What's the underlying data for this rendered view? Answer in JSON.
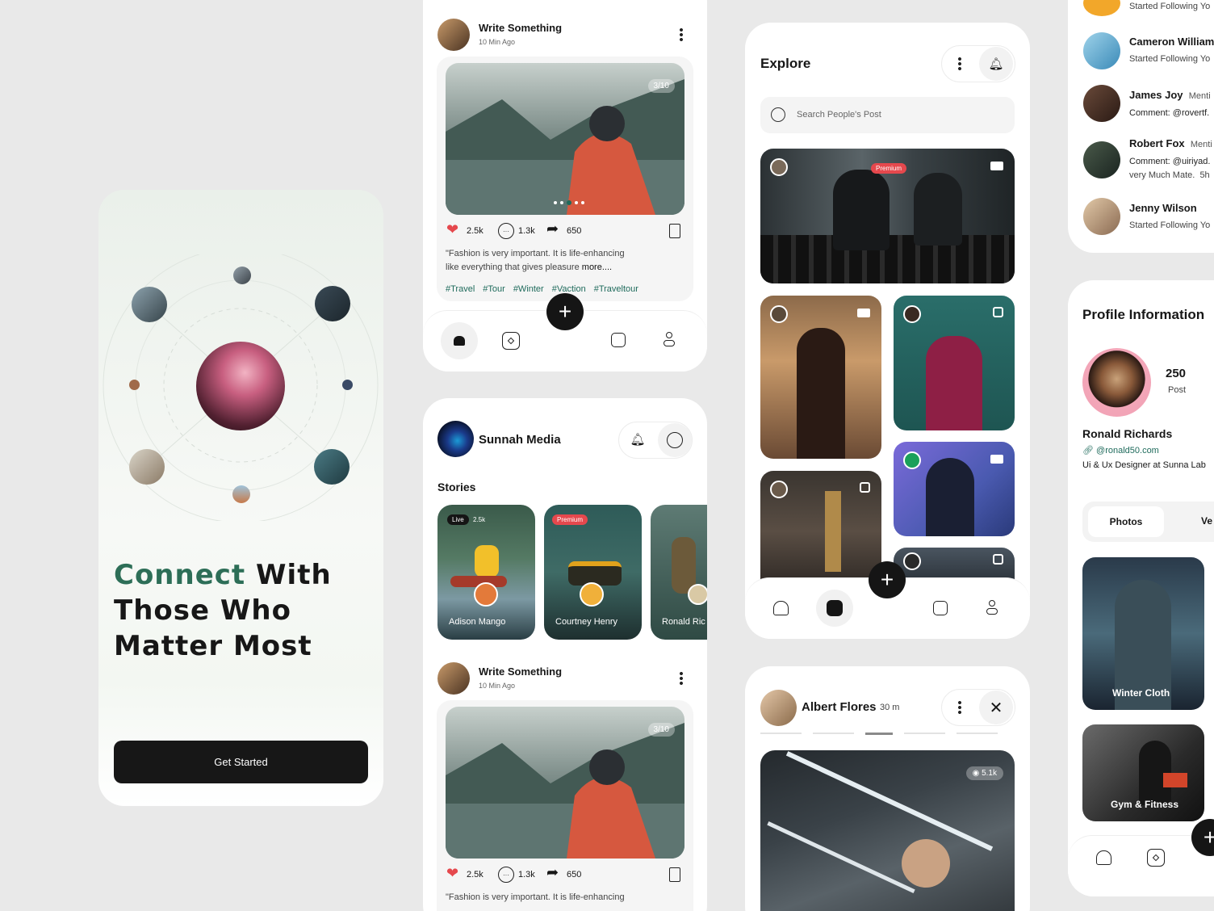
{
  "onboarding": {
    "headline_accent": "Connect",
    "headline_1": "With",
    "headline_2": "Those Who",
    "headline_3": "Matter Most",
    "cta": "Get Started"
  },
  "post": {
    "title": "Write Something",
    "time": "10 Min Ago",
    "counter": "3/10",
    "likes": "2.5k",
    "comments": "1.3k",
    "shares": "650",
    "caption_1": "\"Fashion is very important. It is life-enhancing",
    "caption_2": "like everything that gives pleasure",
    "more": "more....",
    "tags": [
      "#Travel",
      "#Tour",
      "#Winter",
      "#Vaction",
      "#Traveltour"
    ]
  },
  "feed": {
    "brand": "Sunnah Media",
    "stories_title": "Stories",
    "stories": [
      {
        "name": "Adison Mango",
        "badge": "Live",
        "count": "2.5k"
      },
      {
        "name": "Courtney Henry",
        "badge": "Premium"
      },
      {
        "name": "Ronald Ric"
      }
    ]
  },
  "explore": {
    "title": "Explore",
    "search_placeholder": "Search People's Post",
    "premium": "Premium"
  },
  "story_view": {
    "name": "Albert Flores",
    "time": "30 m",
    "views": "5.1k"
  },
  "notifications": [
    {
      "name": "",
      "text": "Started Following Yo"
    },
    {
      "name": "Cameron William",
      "text": "Started Following Yo"
    },
    {
      "name": "James Joy",
      "tail": "Menti",
      "text": "Comment: @rovertf."
    },
    {
      "name": "Robert Fox",
      "tail": "Menti",
      "text": "Comment: @uiriyad.",
      "text2": "very Much Mate.",
      "time": "5h"
    },
    {
      "name": "Jenny Wilson",
      "text": "Started Following Yo"
    }
  ],
  "profile": {
    "title": "Profile Information",
    "posts": "250",
    "posts_label": "Post",
    "name": "Ronald Richards",
    "link": "@ronald50.com",
    "bio": "Ui & Ux Designer at Sunna Lab",
    "tabs": [
      "Photos",
      "Ve"
    ],
    "albums": [
      "Winter Cloth",
      "Gym & Fitness"
    ]
  },
  "colors": {
    "accent": "#1f6b5c",
    "dark": "#151515",
    "like": "#e5484d"
  }
}
